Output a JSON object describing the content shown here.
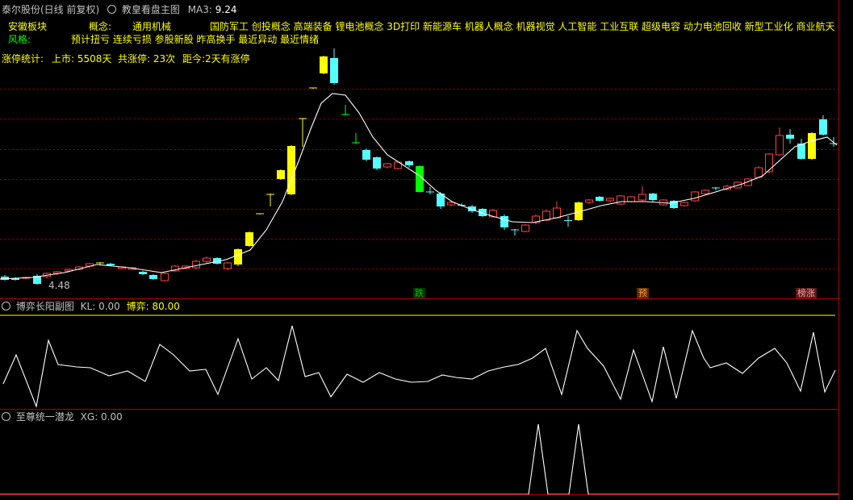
{
  "header": {
    "stock_name": "泰尔股份(日线 前复权)",
    "indicator_name": "教皇看盘主图",
    "ma3_label": "MA3:",
    "ma3_value": "9.24"
  },
  "info": {
    "region": "安徽板块",
    "concept_label": "概念:",
    "industry": "通用机械",
    "concepts": "国防军工 创投概念 高端装备 锂电池概念 3D打印 新能源车 机器人概念 机器视觉 人工智能 工业互联 超级电容 动力电池回收 新型工业化 商业航天",
    "style_label": "风格:",
    "styles": "预计扭亏 连续亏损 参股新股 昨高换手 最近异动 最近情绪",
    "limit_stat_label": "涨停统计:",
    "listed": "上市: 5508天",
    "limit_count": "共涨停: 23次",
    "since_last": "距今:2天有涨停"
  },
  "main_chart": {
    "low_label": "4.48",
    "signals": [
      {
        "text": "跌",
        "color": "#00c000",
        "bg": "#003300"
      },
      {
        "text": "预",
        "color": "#ffa040",
        "bg": "#5a2a00"
      },
      {
        "text": "榜涨",
        "color": "#ffa0a0",
        "bg": "#5a1a1a"
      }
    ]
  },
  "sub1": {
    "title": "博弈长阳副图",
    "kl_label": "KL: 0.00",
    "game_label": "博弈: 80.00"
  },
  "sub2": {
    "title": "至尊统一潜龙",
    "xg_label": "XG: 0.00"
  },
  "colors": {
    "up": "#ff4040",
    "down": "#54ffff",
    "limit_up": "#ffff00",
    "limit_down": "#00ff00",
    "text_yellow": "#ffff00",
    "text_green": "#00ff00",
    "line": "#ffffff"
  }
}
